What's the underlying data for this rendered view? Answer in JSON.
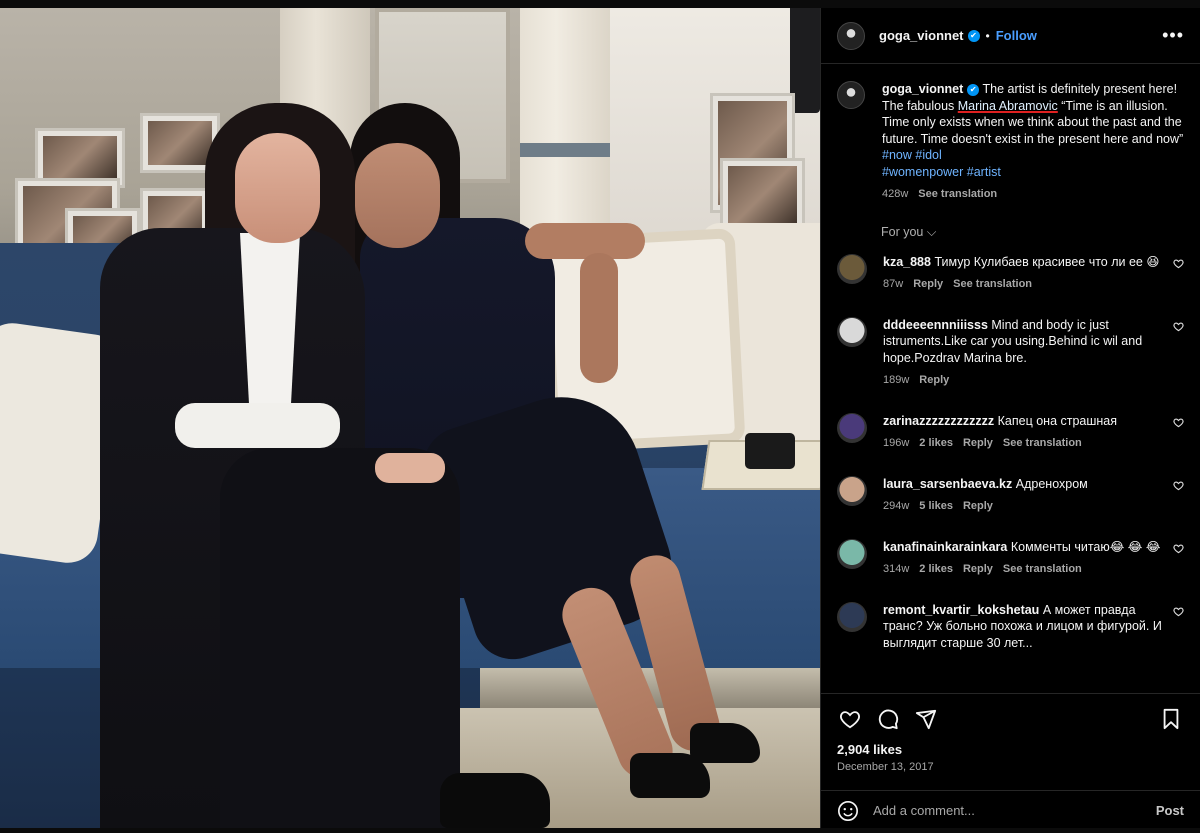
{
  "post": {
    "username": "goga_vionnet",
    "follow_label": "Follow",
    "more_label": "•••",
    "caption_intro": "The artist is definitely present here! The fabulous ",
    "caption_highlight": "Marina Abramovic",
    "caption_rest": " “Time is an illusion. Time only exists when we think about the past and the future. Time doesn't exist in the present here and now” ",
    "hashtags": [
      "#now",
      "#idol",
      "#womenpower",
      "#artist"
    ],
    "caption_time": "428w",
    "caption_translation": "See translation",
    "for_you_label": "For you"
  },
  "comments": [
    {
      "user": "kza_888",
      "text": "Тимур Кулибаев красивее что ли ее 😆",
      "time": "87w",
      "likes": "",
      "reply": "Reply",
      "translation": "See translation",
      "avatar_color": "#6b5a3a"
    },
    {
      "user": "dddeeeennniiisss",
      "text": "Mind and body ic just istruments.Like car you using.Behind ic wil and hope.Pozdrav Marina bre.",
      "time": "189w",
      "likes": "",
      "reply": "Reply",
      "translation": "",
      "avatar_color": "#d9d9d9"
    },
    {
      "user": "zarinazzzzzzzzzzzz",
      "text": "Капец она страшная",
      "time": "196w",
      "likes": "2 likes",
      "reply": "Reply",
      "translation": "See translation",
      "avatar_color": "#4a3a7a"
    },
    {
      "user": "laura_sarsenbaeva.kz",
      "text": "Адренохром",
      "time": "294w",
      "likes": "5 likes",
      "reply": "Reply",
      "translation": "",
      "avatar_color": "#c9a38a"
    },
    {
      "user": "kanafinainkarainkara",
      "text": "Комменты читаю😂 😂 😂",
      "time": "314w",
      "likes": "2 likes",
      "reply": "Reply",
      "translation": "See translation",
      "avatar_color": "#7ab8a8"
    },
    {
      "user": "remont_kvartir_kokshetau",
      "text": "А может правда транс? Уж больно похожа и лицом и фигурой. И выглядит старше 30 лет...",
      "time": "",
      "likes": "",
      "reply": "",
      "translation": "",
      "avatar_color": "#2d3a55"
    }
  ],
  "footer": {
    "likes": "2,904 likes",
    "date": "December 13, 2017",
    "comment_placeholder": "Add a comment...",
    "post_label": "Post"
  },
  "icons": [
    "heart-icon",
    "comment-icon",
    "share-icon",
    "bookmark-icon",
    "emoji-icon",
    "verified-icon",
    "chevron-down-icon",
    "more-icon"
  ]
}
